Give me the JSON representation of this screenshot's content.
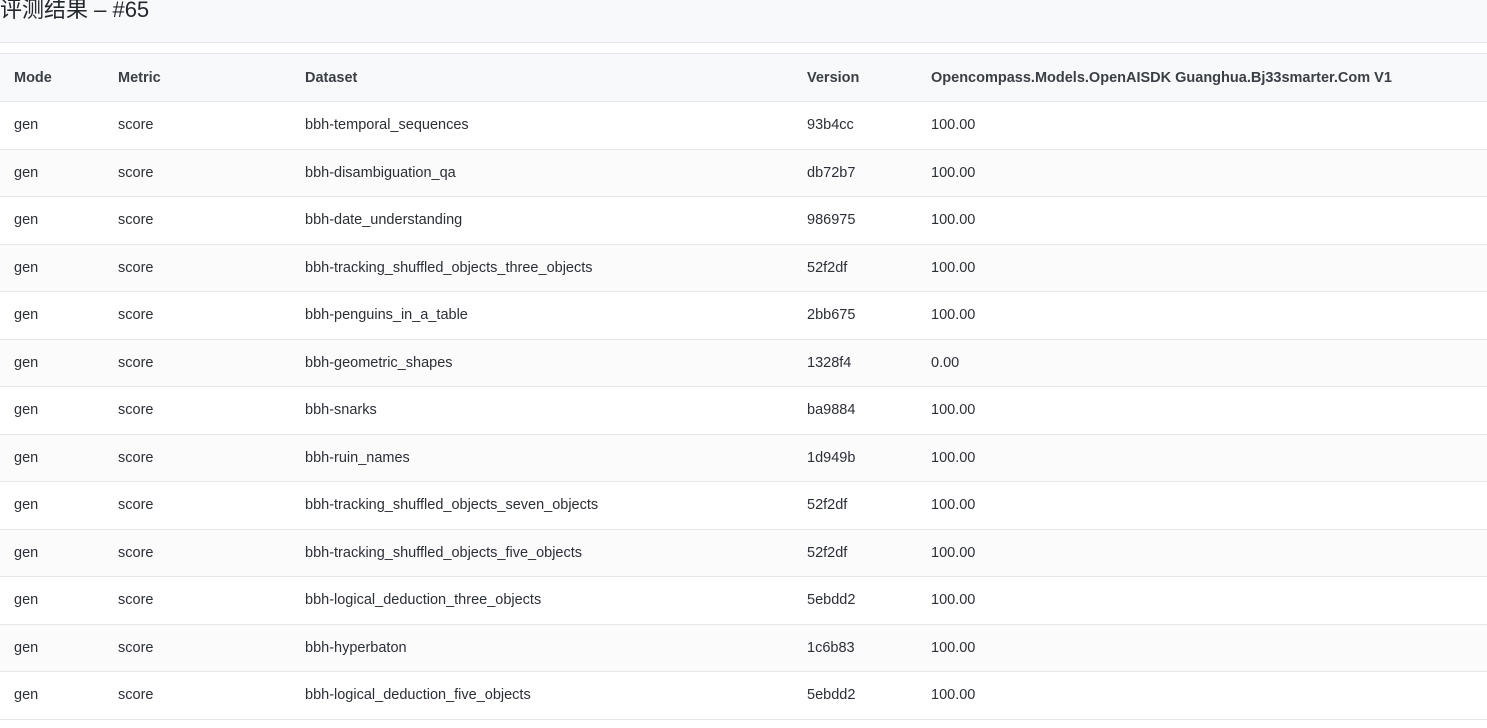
{
  "header": {
    "title": "评测结果 – #65"
  },
  "table": {
    "columns": [
      "Mode",
      "Metric",
      "Dataset",
      "Version",
      "Opencompass.Models.OpenAISDK Guanghua.Bj33smarter.Com V1"
    ],
    "rows": [
      {
        "mode": "gen",
        "metric": "score",
        "dataset": "bbh-temporal_sequences",
        "version": "93b4cc",
        "value": "100.00"
      },
      {
        "mode": "gen",
        "metric": "score",
        "dataset": "bbh-disambiguation_qa",
        "version": "db72b7",
        "value": "100.00"
      },
      {
        "mode": "gen",
        "metric": "score",
        "dataset": "bbh-date_understanding",
        "version": "986975",
        "value": "100.00"
      },
      {
        "mode": "gen",
        "metric": "score",
        "dataset": "bbh-tracking_shuffled_objects_three_objects",
        "version": "52f2df",
        "value": "100.00"
      },
      {
        "mode": "gen",
        "metric": "score",
        "dataset": "bbh-penguins_in_a_table",
        "version": "2bb675",
        "value": "100.00"
      },
      {
        "mode": "gen",
        "metric": "score",
        "dataset": "bbh-geometric_shapes",
        "version": "1328f4",
        "value": "0.00"
      },
      {
        "mode": "gen",
        "metric": "score",
        "dataset": "bbh-snarks",
        "version": "ba9884",
        "value": "100.00"
      },
      {
        "mode": "gen",
        "metric": "score",
        "dataset": "bbh-ruin_names",
        "version": "1d949b",
        "value": "100.00"
      },
      {
        "mode": "gen",
        "metric": "score",
        "dataset": "bbh-tracking_shuffled_objects_seven_objects",
        "version": "52f2df",
        "value": "100.00"
      },
      {
        "mode": "gen",
        "metric": "score",
        "dataset": "bbh-tracking_shuffled_objects_five_objects",
        "version": "52f2df",
        "value": "100.00"
      },
      {
        "mode": "gen",
        "metric": "score",
        "dataset": "bbh-logical_deduction_three_objects",
        "version": "5ebdd2",
        "value": "100.00"
      },
      {
        "mode": "gen",
        "metric": "score",
        "dataset": "bbh-hyperbaton",
        "version": "1c6b83",
        "value": "100.00"
      },
      {
        "mode": "gen",
        "metric": "score",
        "dataset": "bbh-logical_deduction_five_objects",
        "version": "5ebdd2",
        "value": "100.00"
      }
    ]
  }
}
